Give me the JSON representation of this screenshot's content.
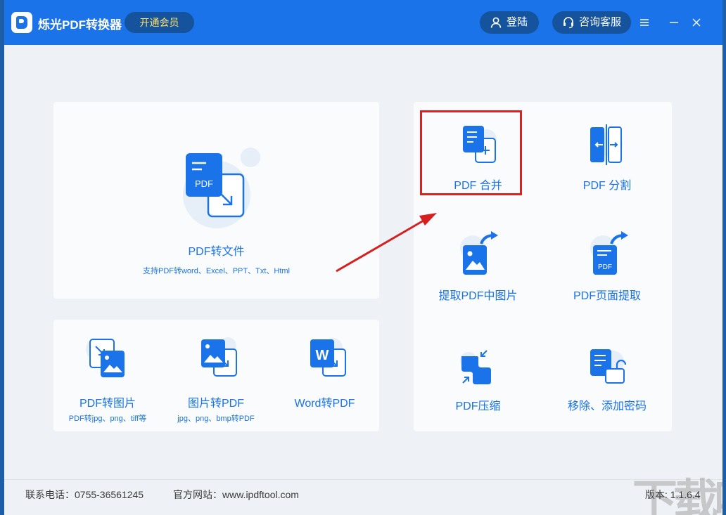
{
  "titlebar": {
    "app_title": "烁光PDF转换器",
    "vip_label": "开通会员",
    "login_label": "登陆",
    "service_label": "咨询客服"
  },
  "main_card": {
    "title": "PDF转文件",
    "subtitle": "支持PDF转word、Excel、PPT、Txt、Html",
    "icon_text": "PDF"
  },
  "bottom_cards": [
    {
      "title": "PDF转图片",
      "subtitle": "PDF转jpg、png、tiff等"
    },
    {
      "title": "图片转PDF",
      "subtitle": "jpg、png、bmp转PDF"
    },
    {
      "title": "Word转PDF",
      "subtitle": "",
      "icon_text": "W"
    }
  ],
  "tools": [
    {
      "title": "PDF 合并"
    },
    {
      "title": "PDF 分割"
    },
    {
      "title": "提取PDF中图片"
    },
    {
      "title": "PDF页面提取",
      "icon_text": "PDF"
    },
    {
      "title": "PDF压缩"
    },
    {
      "title": "移除、添加密码"
    }
  ],
  "footer": {
    "phone": "联系电话：0755-36561245",
    "website": "官方网站：www.ipdftool.com",
    "version": "版本: 1.1.6.4"
  },
  "watermark": "下载吧",
  "colors": {
    "brand": "#1a73e8",
    "highlight": "#e02020",
    "vip_text": "#ffe16b"
  }
}
